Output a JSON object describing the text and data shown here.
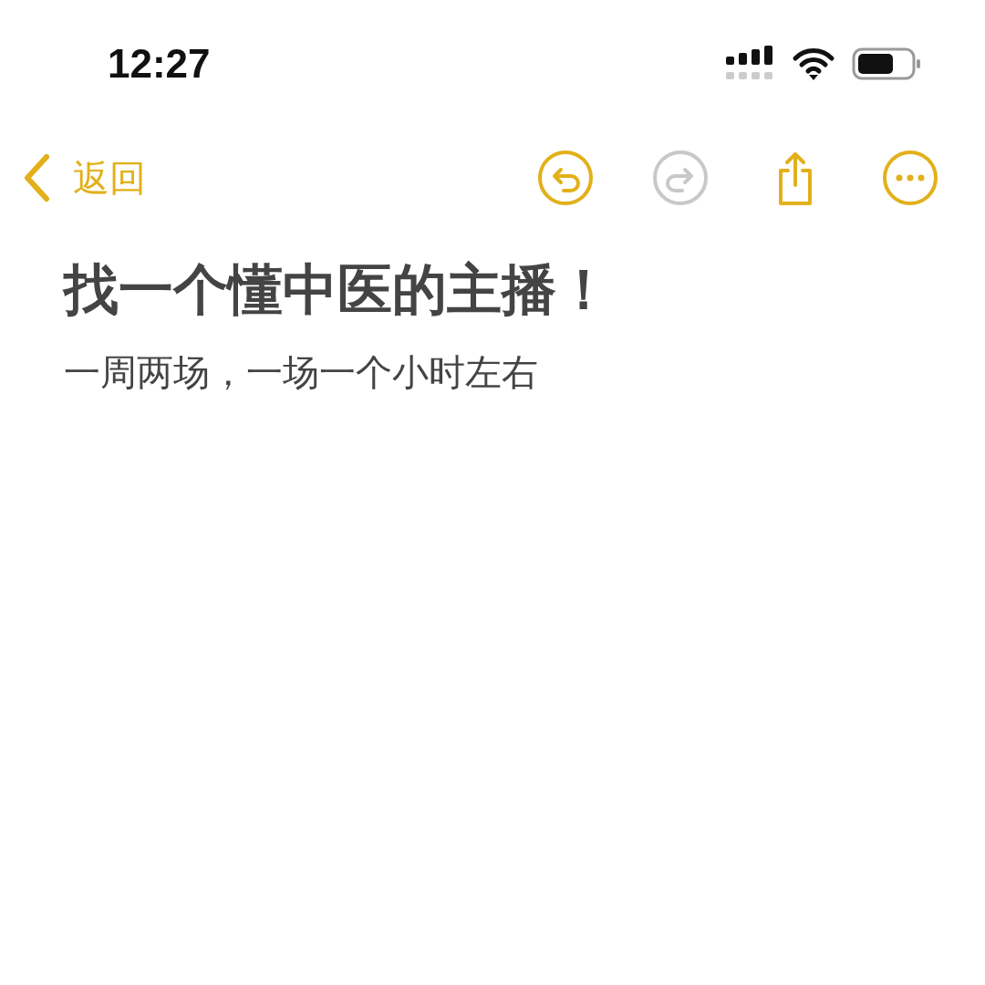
{
  "status_bar": {
    "time": "12:27"
  },
  "nav": {
    "back_label": "返回",
    "actions": [
      {
        "kind": "undo",
        "disabled": false
      },
      {
        "kind": "redo",
        "disabled": true
      },
      {
        "kind": "share",
        "disabled": false
      },
      {
        "kind": "more",
        "disabled": false
      }
    ]
  },
  "note": {
    "title": "找一个懂中医的主播！",
    "body": "一周两场，一场一个小时左右"
  }
}
